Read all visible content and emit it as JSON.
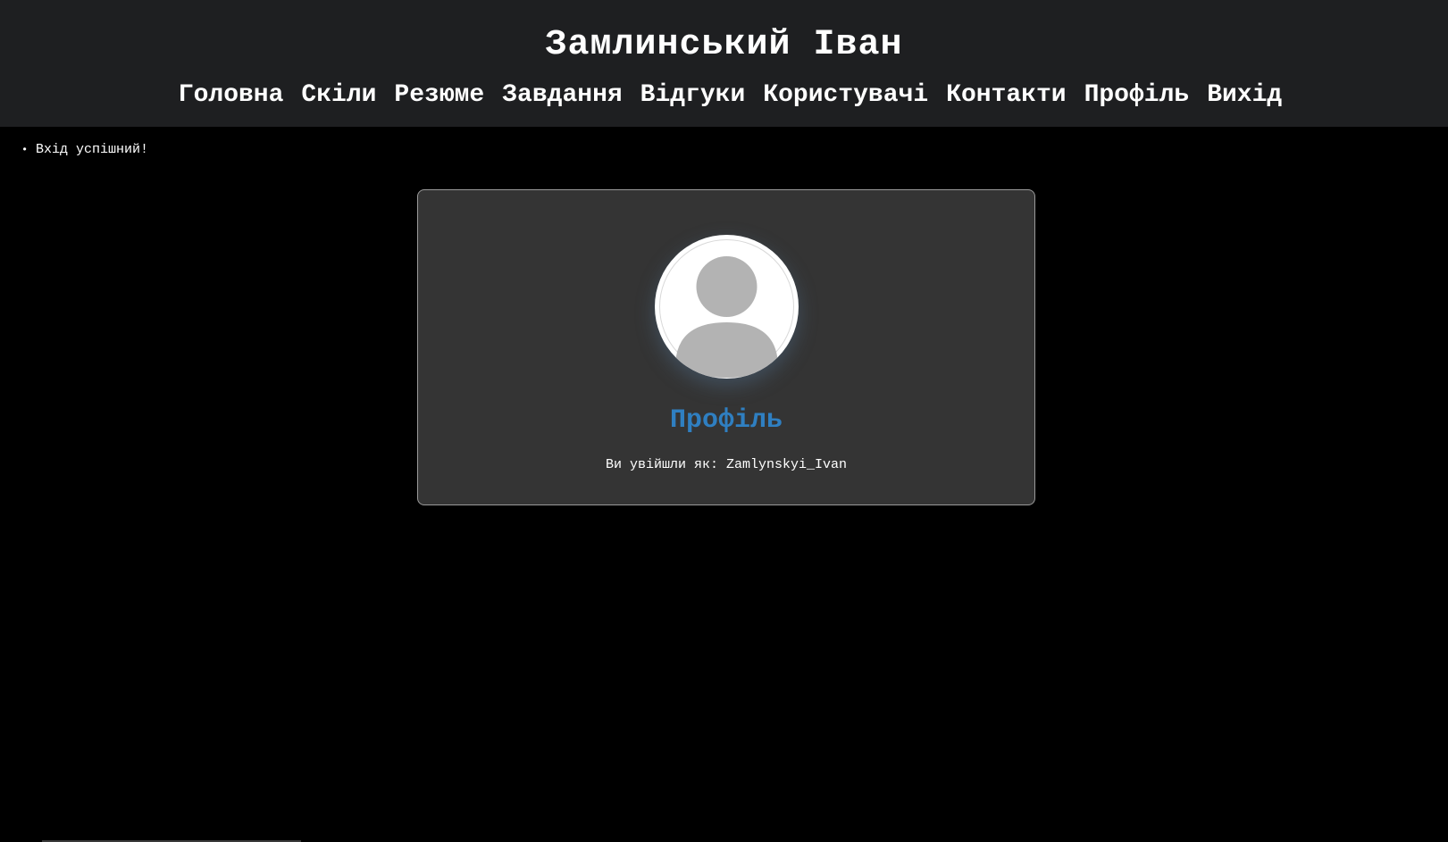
{
  "header": {
    "title": "Замлинський Іван"
  },
  "nav": {
    "items": [
      {
        "label": "Головна"
      },
      {
        "label": "Скіли"
      },
      {
        "label": "Резюме"
      },
      {
        "label": "Завдання"
      },
      {
        "label": "Відгуки"
      },
      {
        "label": "Користувачі"
      },
      {
        "label": "Контакти"
      },
      {
        "label": "Профіль"
      },
      {
        "label": "Вихід"
      }
    ]
  },
  "flash": {
    "messages": [
      "Вхід успішний!"
    ]
  },
  "profile": {
    "avatar_icon": "user-avatar-icon",
    "title": "Профіль",
    "login_label": "Ви увійшли як:",
    "username": "Zamlynskyi_Ivan"
  },
  "colors": {
    "page_bg": "#000000",
    "header_bg": "#1e1f21",
    "card_bg": "#343434",
    "accent": "#2f7fc1"
  }
}
